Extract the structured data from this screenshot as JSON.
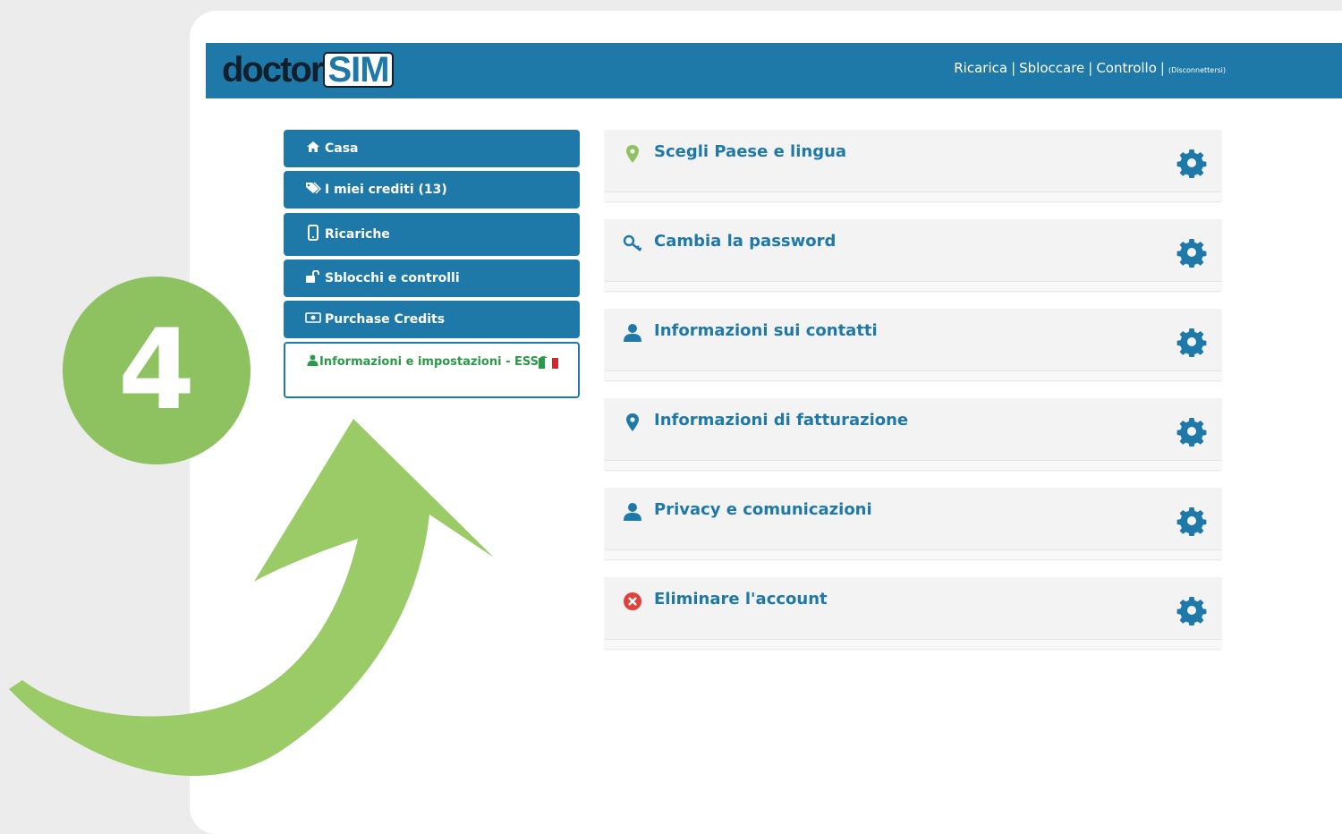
{
  "header": {
    "logo_text": "doctor",
    "logo_badge": "SIM",
    "nav": {
      "recharge": "Ricarica",
      "unlock": "Sbloccare",
      "check": "Controllo",
      "separator": "|",
      "logout": "(Disconnettersi)"
    }
  },
  "sidebar": {
    "items": [
      {
        "label": "Casa",
        "icon": "home-icon"
      },
      {
        "label": "I miei crediti (13)",
        "icon": "tags-icon"
      },
      {
        "label": "Ricariche",
        "icon": "mobile-icon"
      },
      {
        "label": "Sblocchi e controlli",
        "icon": "unlock-icon"
      },
      {
        "label": "Purchase Credits",
        "icon": "money-icon"
      }
    ],
    "active": {
      "label": "Informazioni e impostazioni - ESSO",
      "icon": "user-icon",
      "flag": "italy-flag-icon"
    }
  },
  "panels": [
    {
      "title": "Scegli Paese e lingua",
      "icon": "map-marker-icon",
      "icon_color": "#8ec15f"
    },
    {
      "title": "Cambia la password",
      "icon": "key-icon",
      "icon_color": "#1f79a8"
    },
    {
      "title": "Informazioni sui contatti",
      "icon": "user-icon",
      "icon_color": "#1f79a8"
    },
    {
      "title": "Informazioni di fatturazione",
      "icon": "map-marker-icon",
      "icon_color": "#1f79a8"
    },
    {
      "title": "Privacy e comunicazioni",
      "icon": "user-icon",
      "icon_color": "#1f79a8"
    },
    {
      "title": "Eliminare l'account",
      "icon": "times-circle-icon",
      "icon_color": "#e0413a"
    }
  ],
  "overlay": {
    "step_number": "4",
    "accent_color": "#8ec15f"
  },
  "colors": {
    "brand_blue": "#1f79a8",
    "active_text_green": "#2a9a4a"
  }
}
